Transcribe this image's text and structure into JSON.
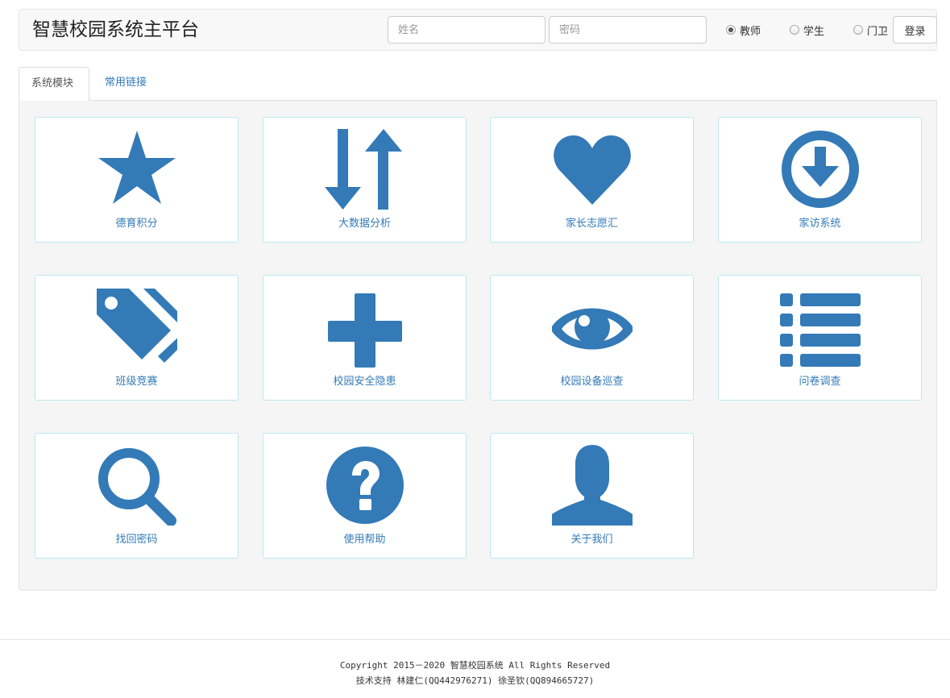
{
  "header": {
    "title": "智慧校园系统主平台",
    "name_placeholder": "姓名",
    "password_placeholder": "密码",
    "roles": [
      "教师",
      "学生",
      "门卫"
    ],
    "selected_role": "教师",
    "login_label": "登录"
  },
  "tabs": [
    {
      "label": "系统模块",
      "active": true
    },
    {
      "label": "常用链接",
      "active": false
    }
  ],
  "modules": [
    {
      "label": "德育积分",
      "icon": "star-icon"
    },
    {
      "label": "大数据分析",
      "icon": "sort-arrows-icon"
    },
    {
      "label": "家长志愿汇",
      "icon": "heart-icon"
    },
    {
      "label": "家访系统",
      "icon": "download-circle-icon"
    },
    {
      "label": "班级竞赛",
      "icon": "tags-icon"
    },
    {
      "label": "校园安全隐患",
      "icon": "plus-icon"
    },
    {
      "label": "校园设备巡查",
      "icon": "eye-icon"
    },
    {
      "label": "问卷调查",
      "icon": "list-icon"
    },
    {
      "label": "找回密码",
      "icon": "search-icon"
    },
    {
      "label": "使用帮助",
      "icon": "question-circle-icon"
    },
    {
      "label": "关于我们",
      "icon": "user-icon"
    }
  ],
  "colors": {
    "icon": "#337ab7",
    "tile_border": "#bce8f1",
    "panel_bg": "#f5f5f5"
  },
  "footer": {
    "copyright": "Copyright 2015－2020 智慧校园系统 All Rights Reserved",
    "support": "技术支持 林建仁(QQ442976271) 徐圣钦(QQ894665727)"
  }
}
